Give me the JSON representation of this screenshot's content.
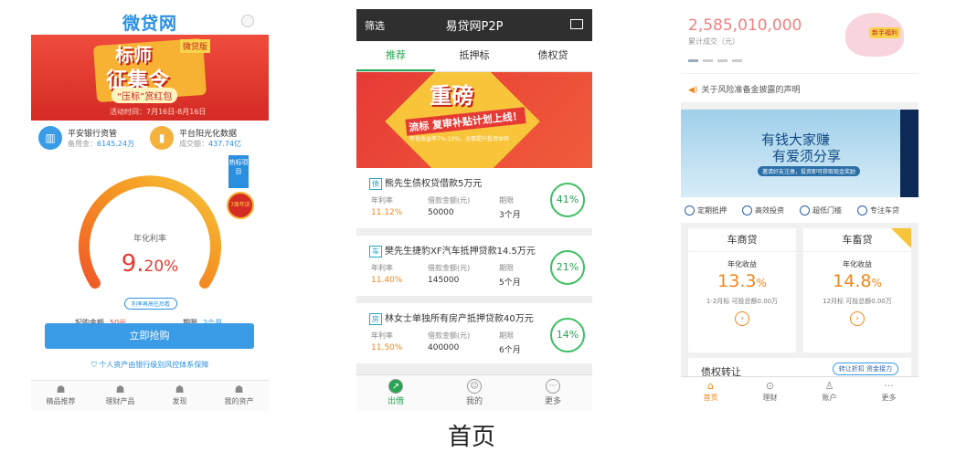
{
  "caption": "首页",
  "screen1": {
    "logo": "微贷网",
    "banner": {
      "tag": "微贷版",
      "title1": "标师",
      "title2": "征集令",
      "subtitle": "“压标”赏红包",
      "date": "活动时间：7月16日-8月16日"
    },
    "info": [
      {
        "icon": "bank-icon",
        "title": "平安银行资管",
        "label": "备用金：",
        "value": "6145.24万"
      },
      {
        "icon": "chart-icon",
        "title": "平台阳光化数据",
        "label": "成交额：",
        "value": "437.74亿"
      }
    ],
    "corner_tag": "热标项目",
    "badge": "7周年庆",
    "rate_label": "年化利率",
    "rate_value": "9.",
    "rate_decimal": "20%",
    "rule_link": "利率再高往后看",
    "min_label": "起购金额",
    "min_value": "50元",
    "term_label": "期限",
    "term_value": "2个月",
    "buy_button": "立即抢购",
    "safety": "个人资产由银行级别风控体系保障",
    "nav": [
      "精品推荐",
      "理财产品",
      "发现",
      "我的资产"
    ]
  },
  "screen2": {
    "filter": "筛选",
    "title": "易贷网P2P",
    "tabs": [
      "推荐",
      "抵押标",
      "债权贷"
    ],
    "active_tab": 0,
    "banner": {
      "headline": "重磅",
      "subline": "流标 复审补贴计划上线！",
      "small": "年化收益率7%-10%，全面提升投资体验"
    },
    "loans": [
      {
        "tag": "债",
        "name": "熊先生债权贷借款5万元",
        "rate_label": "年利率",
        "rate": "11.12%",
        "amount_label": "借款金额(元)",
        "amount": "50000",
        "term_label": "期限",
        "term": "3个月",
        "progress": "41%"
      },
      {
        "tag": "车",
        "name": "樊先生捷豹XF汽车抵押贷款14.5万元",
        "rate_label": "年利率",
        "rate": "11.40%",
        "amount_label": "借款金额(元)",
        "amount": "145000",
        "term_label": "期限",
        "term": "5个月",
        "progress": "21%"
      },
      {
        "tag": "房",
        "name": "林女士单独所有房产抵押贷款40万元",
        "rate_label": "年利率",
        "rate": "11.50%",
        "amount_label": "借款金额(元)",
        "amount": "400000",
        "term_label": "期限",
        "term": "6个月",
        "progress": "14%"
      }
    ],
    "nav": [
      "出借",
      "我的",
      "更多"
    ]
  },
  "screen3": {
    "amount": "2,585,010,000",
    "amount_label": "累计成交（元）",
    "pig_tag": "新手福利",
    "notice": "关于风险准备金披露的声明",
    "banner": {
      "line1": "有钱大家赚",
      "line2": "有爱须分享",
      "small": "邀请好友注册，投资即可获取现金奖励"
    },
    "features": [
      "定期抵押",
      "高效投资",
      "超低门槛",
      "专注车贷"
    ],
    "products": [
      {
        "title": "车商贷",
        "label": "年化收益",
        "value": "13.3",
        "unit": "%",
        "meta": "1-2月标  可投总额0.00万"
      },
      {
        "title": "车畜贷",
        "label": "年化收益",
        "value": "14.8",
        "unit": "%",
        "meta": "12月标  可投总额0.00万"
      }
    ],
    "debt_title": "债权转让",
    "debt_button": "转让折扣 资金接力",
    "nav": [
      "首页",
      "理财",
      "账户",
      "更多"
    ]
  }
}
